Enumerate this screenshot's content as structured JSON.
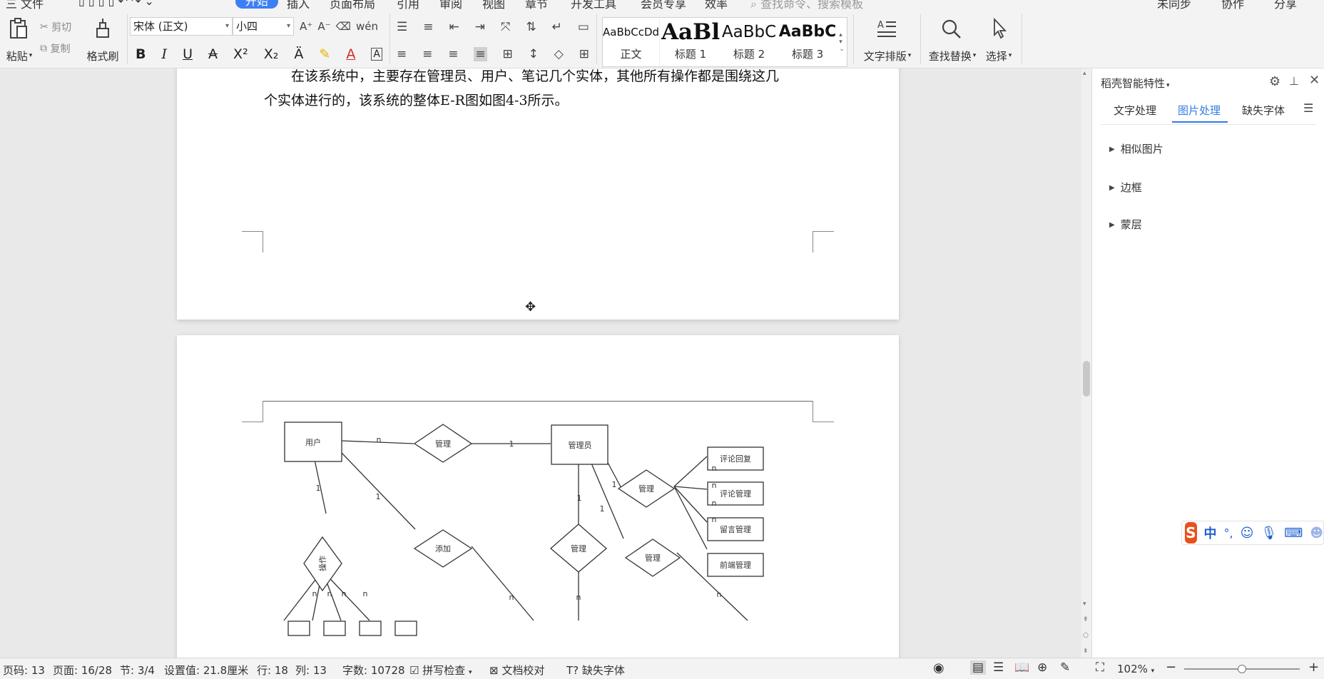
{
  "menubar": {
    "items": [
      "三 文件",
      "开始",
      "插入",
      "页面布局",
      "引用",
      "审阅",
      "视图",
      "章节",
      "开发工具",
      "会员专享",
      "效率"
    ],
    "search_placeholder": "查找命令、搜索模板",
    "right": [
      "未同步",
      "协作",
      "分享"
    ]
  },
  "ribbon": {
    "clipboard": {
      "paste": "粘贴",
      "cut": "剪切",
      "copy": "复制",
      "format_painter": "格式刷"
    },
    "font": {
      "name": "宋体 (正文)",
      "size": "小四"
    },
    "styles": [
      {
        "sample": "AaBbCcDd",
        "name": "正文"
      },
      {
        "sample": "AaBl",
        "name": "标题 1"
      },
      {
        "sample": "AaBbC",
        "name": "标题 2"
      },
      {
        "sample": "AaBbC",
        "name": "标题 3"
      }
    ],
    "text_layout": "文字排版",
    "find_replace": "查找替换",
    "select": "选择"
  },
  "document": {
    "paragraph_line1": "在该系统中，主要存在管理员、用户、笔记几个实体，其他所有操作都是围绕这几",
    "paragraph_line2": "个实体进行的，该系统的整体E-R图如图4-3所示。"
  },
  "er_diagram": {
    "entities": [
      "用户",
      "管理员",
      "评论回复",
      "评论管理",
      "留言管理",
      "前端管理"
    ],
    "relations": [
      "管理",
      "添加",
      "操作",
      "管理",
      "管理",
      "管理"
    ],
    "cardinalities": [
      "n",
      "1",
      "1",
      "1",
      "1",
      "n",
      "n",
      "n",
      "n",
      "1",
      "1",
      "n",
      "n",
      "n",
      "n",
      "n",
      "n"
    ]
  },
  "right_panel": {
    "title": "稻壳智能特性",
    "tabs": [
      "文字处理",
      "图片处理",
      "缺失字体"
    ],
    "active_tab": "图片处理",
    "sections": [
      "相似图片",
      "边框",
      "蒙层"
    ]
  },
  "ime": {
    "mode": "中",
    "punct": "°,",
    "logo": "S"
  },
  "statusbar": {
    "page_no": "页码: 13",
    "pages": "页面: 16/28",
    "section": "节: 3/4",
    "position": "设置值: 21.8厘米",
    "row": "行: 18",
    "col": "列: 13",
    "word_count": "字数: 10728",
    "spell_check": "拼写检查",
    "doc_check": "文档校对",
    "missing_font": "缺失字体",
    "zoom": "102%",
    "zoom_level": 0.5
  },
  "colors": {
    "accent": "#3c7ef5",
    "tab_active": "#2f7de1",
    "ime_brand": "#e8511d"
  }
}
